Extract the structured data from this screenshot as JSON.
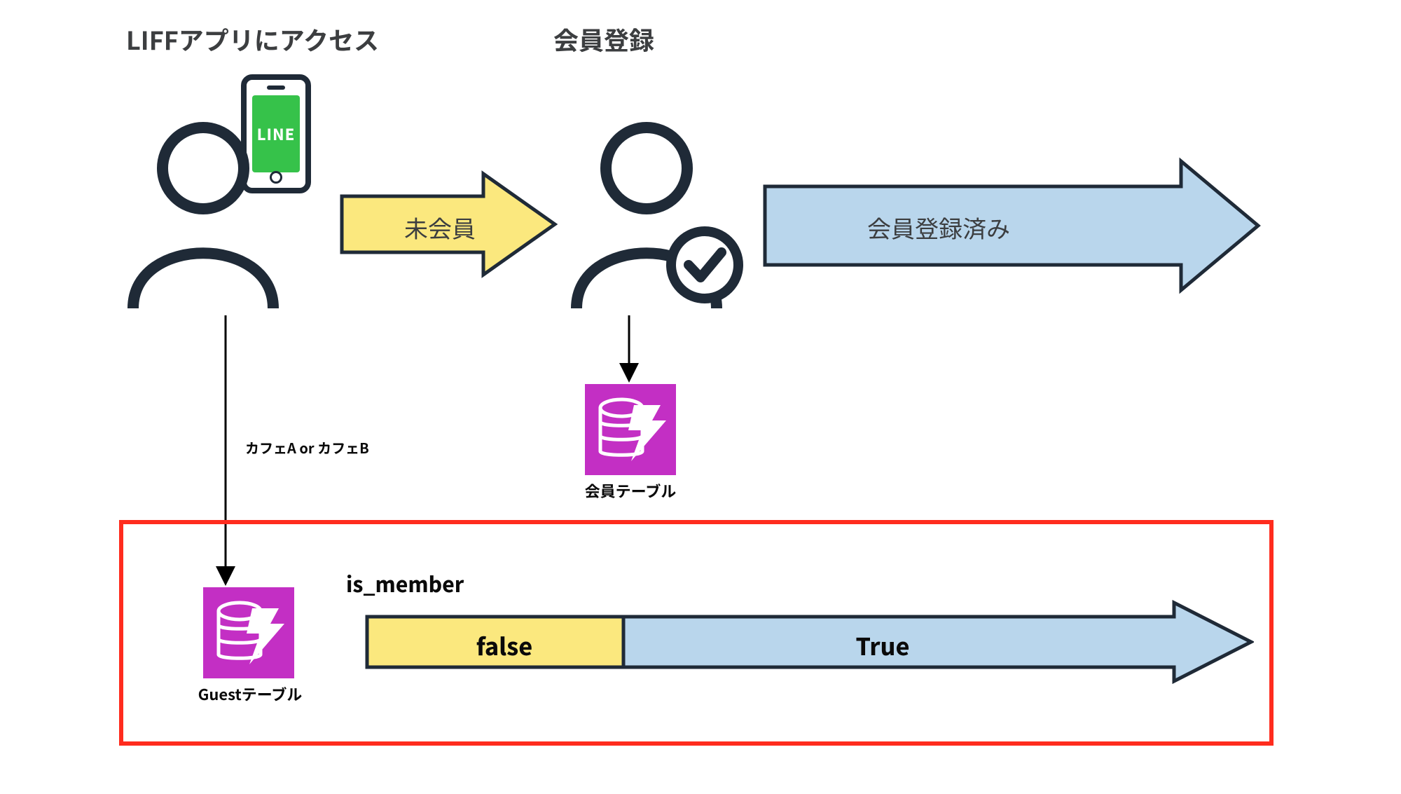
{
  "headings": {
    "access_liff": "LIFFアプリにアクセス",
    "register": "会員登録"
  },
  "arrows": {
    "non_member": "未会員",
    "registered": "会員登録済み"
  },
  "labels": {
    "cafe_branch": "カフェA or カフェB",
    "member_table": "会員テーブル",
    "guest_table": "Guestテーブル",
    "is_member_field": "is_member"
  },
  "bar_arrow": {
    "false_label": "false",
    "true_label": "True"
  },
  "phone": {
    "app_name": "LINE"
  },
  "colors": {
    "yellow": "#fbe87e",
    "blue": "#b9d6ec",
    "magenta": "#c32fc4",
    "red_frame": "#ff2c1e",
    "line_green": "#36c24a",
    "stroke": "#1f2a37"
  }
}
